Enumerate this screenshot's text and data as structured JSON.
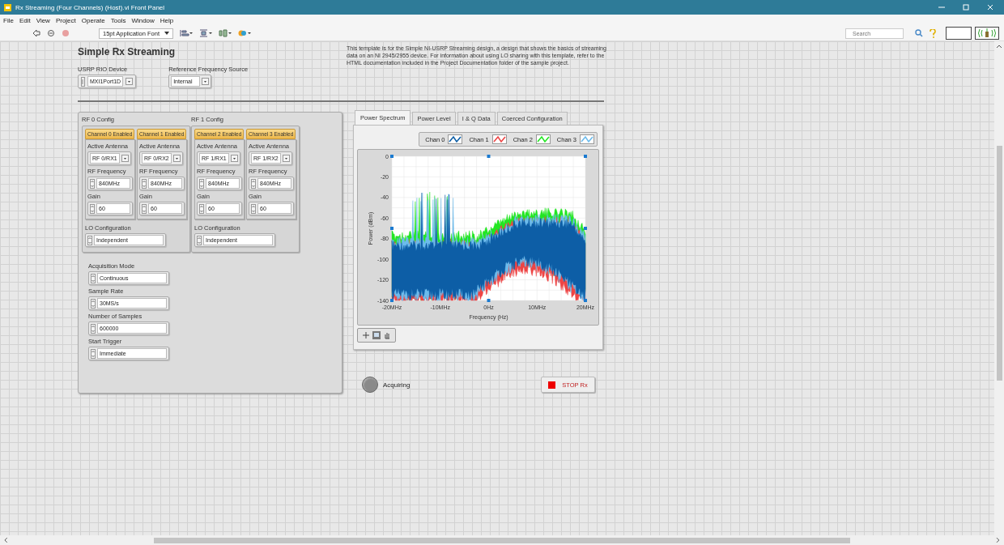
{
  "window": {
    "title": "Rx Streaming (Four Channels) (Host).vi Front Panel"
  },
  "menu": [
    "File",
    "Edit",
    "View",
    "Project",
    "Operate",
    "Tools",
    "Window",
    "Help"
  ],
  "toolbar": {
    "font_select": "15pt Application Font",
    "search": {
      "placeholder": "Search"
    }
  },
  "panel": {
    "title": "Simple Rx Streaming",
    "top_controls": [
      {
        "label": "USRP RIO Device",
        "value": "MXI1Port1D",
        "kind": "io"
      },
      {
        "label": "Reference Frequency Source",
        "value": "Internal",
        "kind": "ring"
      }
    ],
    "description": "This template is for the Simple NI-USRP Streaming design, a design that shows the basics of streaming data on an NI 2945/2955 device. For information about using LO sharing with this template, refer to the HTML documentation included in the Project Documentation folder of the sample project."
  },
  "rf_groups": [
    {
      "label": "RF 0 Config",
      "channels": [
        {
          "button": "Channel 0 Enabled",
          "on": true,
          "controls": [
            {
              "label": "Active Antenna",
              "value": "RF 0/RX1",
              "kind": "ring"
            },
            {
              "label": "RF Frequency",
              "value": "840MHz",
              "kind": "spin"
            },
            {
              "label": "Gain",
              "value": "60",
              "kind": "spin"
            }
          ]
        },
        {
          "button": "Channel 1 Enabled",
          "on": true,
          "controls": [
            {
              "label": "Active Antenna",
              "value": "RF 0/RX2",
              "kind": "ring"
            },
            {
              "label": "RF Frequency",
              "value": "840MHz",
              "kind": "spin"
            },
            {
              "label": "Gain",
              "value": "60",
              "kind": "spin"
            }
          ]
        }
      ],
      "lo": {
        "label": "LO Configuration",
        "value": "Independent",
        "kind": "spin"
      }
    },
    {
      "label": "RF 1 Config",
      "channels": [
        {
          "button": "Channel 2 Enabled",
          "on": true,
          "controls": [
            {
              "label": "Active Antenna",
              "value": "RF 1/RX1",
              "kind": "ring"
            },
            {
              "label": "RF Frequency",
              "value": "840MHz",
              "kind": "spin"
            },
            {
              "label": "Gain",
              "value": "60",
              "kind": "spin"
            }
          ]
        },
        {
          "button": "Channel 3 Enabled",
          "on": true,
          "controls": [
            {
              "label": "Active Antenna",
              "value": "RF 1/RX2",
              "kind": "ring"
            },
            {
              "label": "RF Frequency",
              "value": "840MHz",
              "kind": "spin"
            },
            {
              "label": "Gain",
              "value": "60",
              "kind": "spin"
            }
          ]
        }
      ],
      "lo": {
        "label": "LO Configuration",
        "value": "Independent",
        "kind": "spin"
      }
    }
  ],
  "acquisition": [
    {
      "label": "Acquisition Mode",
      "value": "Continuous",
      "kind": "spin"
    },
    {
      "label": "Sample Rate",
      "value": "30MS/s",
      "kind": "spin"
    },
    {
      "label": "Number of Samples",
      "value": "600000",
      "kind": "spin"
    },
    {
      "label": "Start Trigger",
      "value": "Immediate",
      "kind": "spin"
    }
  ],
  "tabs": [
    {
      "label": "Power Spectrum",
      "selected": true
    },
    {
      "label": "Power Level",
      "selected": false
    },
    {
      "label": "I & Q Data",
      "selected": false
    },
    {
      "label": "Coerced Configuration",
      "selected": false
    }
  ],
  "legend": [
    {
      "name": "Chan 0",
      "color": "#0d5ea6"
    },
    {
      "name": "Chan 1",
      "color": "#ee4444"
    },
    {
      "name": "Chan 2",
      "color": "#22e622"
    },
    {
      "name": "Chan 3",
      "color": "#6cbbec"
    }
  ],
  "chart": {
    "ylabel": "Power (dBm)",
    "xlabel": "Frequency (Hz)",
    "yticks": [
      "0",
      "-20",
      "-40",
      "-60",
      "-80",
      "-100",
      "-120",
      "-140"
    ],
    "xticks": [
      "-20MHz",
      "-10MHz",
      "0Hz",
      "10MHz",
      "20MHz"
    ]
  },
  "indicator": {
    "label": "Acquiring",
    "on": false
  },
  "stop_button": {
    "label": "STOP Rx"
  }
}
